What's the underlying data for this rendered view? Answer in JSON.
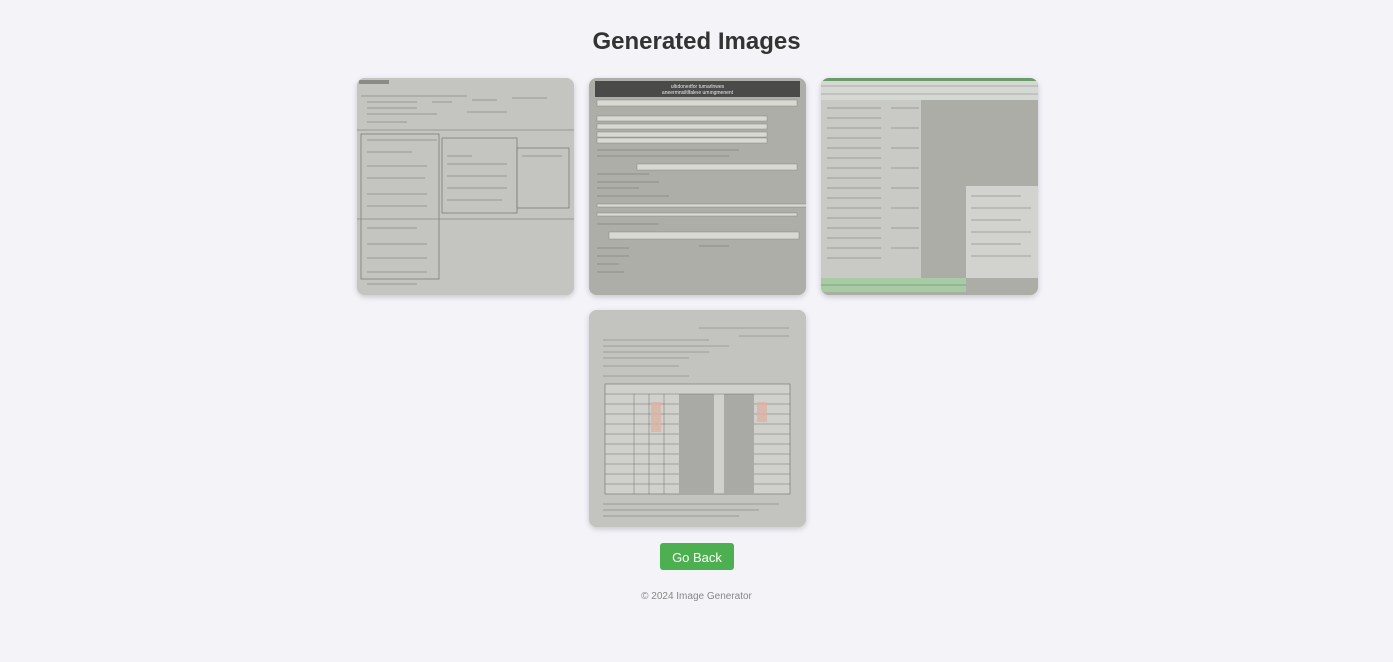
{
  "page": {
    "title": "Generated Images",
    "back_button_label": "Go Back",
    "footer_text": "© 2024 Image Generator",
    "accent_color": "#4caf50",
    "background_color": "#f3f3f8"
  },
  "images": [
    {
      "name": "generated-image-1",
      "description_icon": "form-document-image",
      "header_text": ""
    },
    {
      "name": "generated-image-2",
      "description_icon": "form-document-image",
      "header_text": "ultıdoneıtfor tumarlnwes aneermnsiltlfaleıe umıngmenent"
    },
    {
      "name": "generated-image-3",
      "description_icon": "spreadsheet-image",
      "header_text": ""
    },
    {
      "name": "generated-image-4",
      "description_icon": "table-document-image",
      "header_text": ""
    }
  ]
}
